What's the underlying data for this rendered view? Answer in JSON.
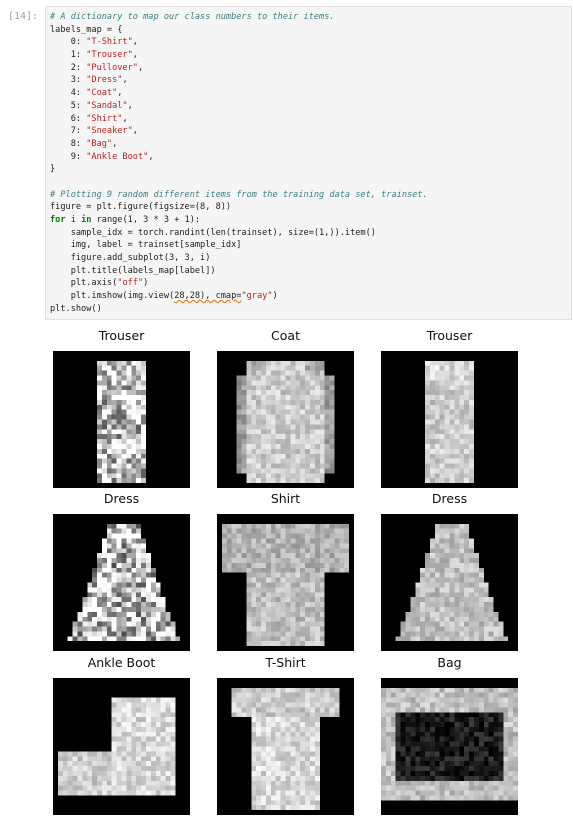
{
  "cell": {
    "prompt": "[14]:",
    "code_lines": [
      [
        {
          "t": "# A dictionary to map our class numbers to their items.",
          "c": "c-comment"
        }
      ],
      [
        {
          "t": "labels_map = {",
          "c": ""
        }
      ],
      [
        {
          "t": "    0: ",
          "c": ""
        },
        {
          "t": "\"T-Shirt\"",
          "c": "c-str"
        },
        {
          "t": ",",
          "c": ""
        }
      ],
      [
        {
          "t": "    1: ",
          "c": ""
        },
        {
          "t": "\"Trouser\"",
          "c": "c-str"
        },
        {
          "t": ",",
          "c": ""
        }
      ],
      [
        {
          "t": "    2: ",
          "c": ""
        },
        {
          "t": "\"Pullover\"",
          "c": "c-str"
        },
        {
          "t": ",",
          "c": ""
        }
      ],
      [
        {
          "t": "    3: ",
          "c": ""
        },
        {
          "t": "\"Dress\"",
          "c": "c-str"
        },
        {
          "t": ",",
          "c": ""
        }
      ],
      [
        {
          "t": "    4: ",
          "c": ""
        },
        {
          "t": "\"Coat\"",
          "c": "c-str"
        },
        {
          "t": ",",
          "c": ""
        }
      ],
      [
        {
          "t": "    5: ",
          "c": ""
        },
        {
          "t": "\"Sandal\"",
          "c": "c-str"
        },
        {
          "t": ",",
          "c": ""
        }
      ],
      [
        {
          "t": "    6: ",
          "c": ""
        },
        {
          "t": "\"Shirt\"",
          "c": "c-str"
        },
        {
          "t": ",",
          "c": ""
        }
      ],
      [
        {
          "t": "    7: ",
          "c": ""
        },
        {
          "t": "\"Sneaker\"",
          "c": "c-str"
        },
        {
          "t": ",",
          "c": ""
        }
      ],
      [
        {
          "t": "    8: ",
          "c": ""
        },
        {
          "t": "\"Bag\"",
          "c": "c-str"
        },
        {
          "t": ",",
          "c": ""
        }
      ],
      [
        {
          "t": "    9: ",
          "c": ""
        },
        {
          "t": "\"Ankle Boot\"",
          "c": "c-str"
        },
        {
          "t": ",",
          "c": ""
        }
      ],
      [
        {
          "t": "}",
          "c": ""
        }
      ],
      [
        {
          "t": "",
          "c": ""
        }
      ],
      [
        {
          "t": "# Plotting 9 random different items from the training data set, trainset.",
          "c": "c-comment"
        }
      ],
      [
        {
          "t": "figure = plt.figure(figsize=(8, 8))",
          "c": ""
        }
      ],
      [
        {
          "t": "for",
          "c": "c-kw"
        },
        {
          "t": " i ",
          "c": ""
        },
        {
          "t": "in",
          "c": "c-kw"
        },
        {
          "t": " range(1, 3 * 3 + 1):",
          "c": ""
        }
      ],
      [
        {
          "t": "    sample_idx = torch.randint(len(trainset), size=(1,)).item()",
          "c": ""
        }
      ],
      [
        {
          "t": "    img, label = trainset[sample_idx]",
          "c": ""
        }
      ],
      [
        {
          "t": "    figure.add_subplot(3, 3, i)",
          "c": ""
        }
      ],
      [
        {
          "t": "    plt.title(labels_map[label])",
          "c": ""
        }
      ],
      [
        {
          "t": "    plt.axis(",
          "c": ""
        },
        {
          "t": "\"off\"",
          "c": "c-str"
        },
        {
          "t": ")",
          "c": ""
        }
      ],
      [
        {
          "t": "    plt.imshow(img.view(",
          "c": ""
        },
        {
          "t": "28,28), cmap=",
          "c": "c-squiggle"
        },
        {
          "t": "\"gray\"",
          "c": "c-str"
        },
        {
          "t": ")",
          "c": ""
        }
      ],
      [
        {
          "t": "plt.show()",
          "c": ""
        }
      ]
    ]
  },
  "output": {
    "panels": [
      {
        "title": "Trouser",
        "kind": "trouser-textured"
      },
      {
        "title": "Coat",
        "kind": "coat"
      },
      {
        "title": "Trouser",
        "kind": "trouser"
      },
      {
        "title": "Dress",
        "kind": "dress-textured"
      },
      {
        "title": "Shirt",
        "kind": "shirt"
      },
      {
        "title": "Dress",
        "kind": "dress"
      },
      {
        "title": "Ankle Boot",
        "kind": "boot"
      },
      {
        "title": "T-Shirt",
        "kind": "tshirt"
      },
      {
        "title": "Bag",
        "kind": "bag"
      }
    ]
  }
}
